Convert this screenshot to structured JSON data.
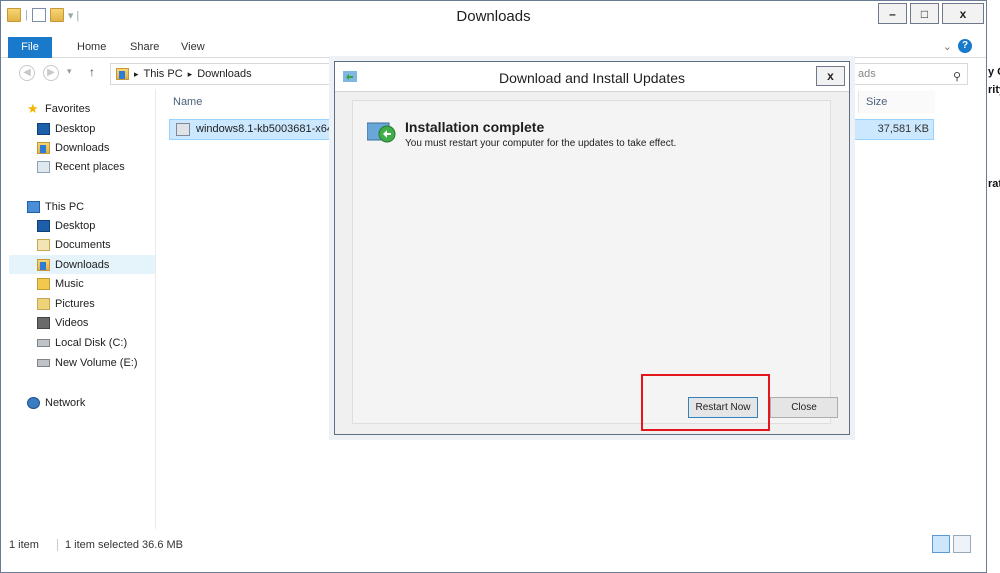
{
  "window": {
    "title": "Downloads"
  },
  "window_controls": {
    "minimize": "–",
    "maximize": "□",
    "close": "x"
  },
  "ribbon": {
    "tabs": [
      "File",
      "Home",
      "Share",
      "View"
    ],
    "expand_glyph": "⌄",
    "help_glyph": "?"
  },
  "address": {
    "crumbs": [
      "This PC",
      "Downloads"
    ],
    "separator": "▸",
    "up_glyph": "↑"
  },
  "search": {
    "visible_text": "ads"
  },
  "nav": {
    "favorites_label": "Favorites",
    "favorites": [
      "Desktop",
      "Downloads",
      "Recent places"
    ],
    "thispc_label": "This PC",
    "thispc": [
      "Desktop",
      "Documents",
      "Downloads",
      "Music",
      "Pictures",
      "Videos",
      "Local Disk (C:)",
      "New Volume (E:)"
    ],
    "selected": "Downloads",
    "network_label": "Network"
  },
  "files": {
    "columns": {
      "name": "Name",
      "size": "Size"
    },
    "rows": [
      {
        "name": "windows8.1-kb5003681-x64_b",
        "size": "37,581 KB"
      }
    ]
  },
  "status": {
    "count": "1 item",
    "selection": "1 item selected  36.6 MB"
  },
  "edge_fragments": [
    "y C",
    "rity",
    "rati"
  ],
  "dialog": {
    "title": "Download and Install Updates",
    "close_glyph": "x",
    "heading": "Installation complete",
    "message": "You must restart your computer for the updates to take effect.",
    "restart_label": "Restart Now",
    "close_label": "Close"
  },
  "colors": {
    "accent": "#1979ca",
    "highlight": "#e4151b",
    "selection": "#cce8ff"
  }
}
